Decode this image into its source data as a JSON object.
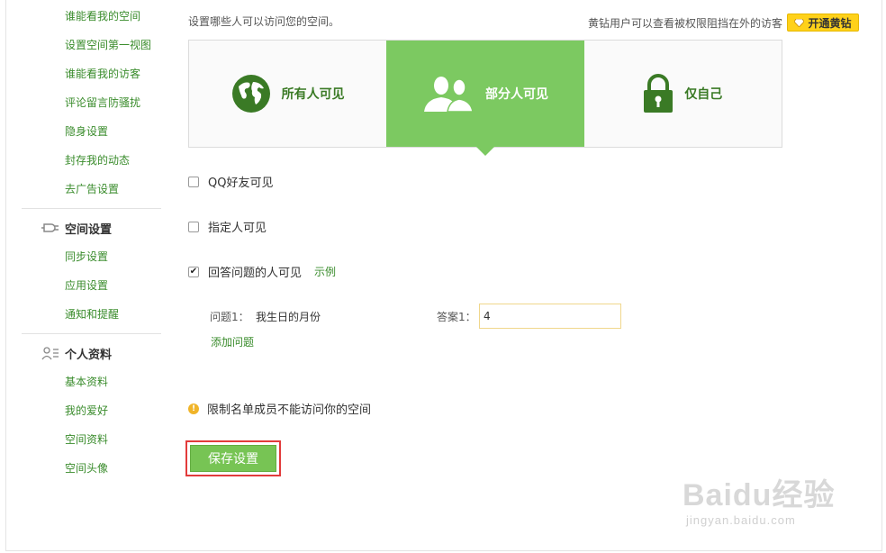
{
  "sidebar": {
    "privacy_items": [
      "谁能看我的空间",
      "设置空间第一视图",
      "谁能看我的访客",
      "评论留言防骚扰",
      "隐身设置",
      "封存我的动态",
      "去广告设置"
    ],
    "space_settings": {
      "title": "空间设置",
      "icon": "plug-icon",
      "items": [
        "同步设置",
        "应用设置",
        "通知和提醒"
      ]
    },
    "personal_info": {
      "title": "个人资料",
      "icon": "user-list-icon",
      "items": [
        "基本资料",
        "我的爱好",
        "空间资料",
        "空间头像"
      ]
    }
  },
  "main": {
    "intro": "设置哪些人可以访问您的空间。",
    "vip_note": "黄钻用户可以查看被权限阻挡在外的访客",
    "vip_button": "开通黄钻",
    "options": [
      {
        "label": "所有人可见",
        "icon": "globe-icon",
        "active": false
      },
      {
        "label": "部分人可见",
        "icon": "people-icon",
        "active": true
      },
      {
        "label": "仅自己",
        "icon": "lock-icon",
        "active": false
      }
    ],
    "checkboxes": [
      {
        "label": "QQ好友可见",
        "checked": false
      },
      {
        "label": "指定人可见",
        "checked": false
      },
      {
        "label": "回答问题的人可见",
        "checked": true
      }
    ],
    "example_link": "示例",
    "question_label": "问题1：",
    "question_value": "我生日的月份",
    "answer_label": "答案1：",
    "answer_value": "4",
    "add_question": "添加问题",
    "warning_text": "限制名单成员不能访问你的空间",
    "save_button": "保存设置"
  },
  "watermark": {
    "logo": "Baidu经验",
    "sub": "jingyan.baidu.com"
  },
  "colors": {
    "accent": "#7cc961",
    "link": "#3a8c2c",
    "vip": "#ffd11a",
    "highlight_box": "#e23b3b"
  }
}
